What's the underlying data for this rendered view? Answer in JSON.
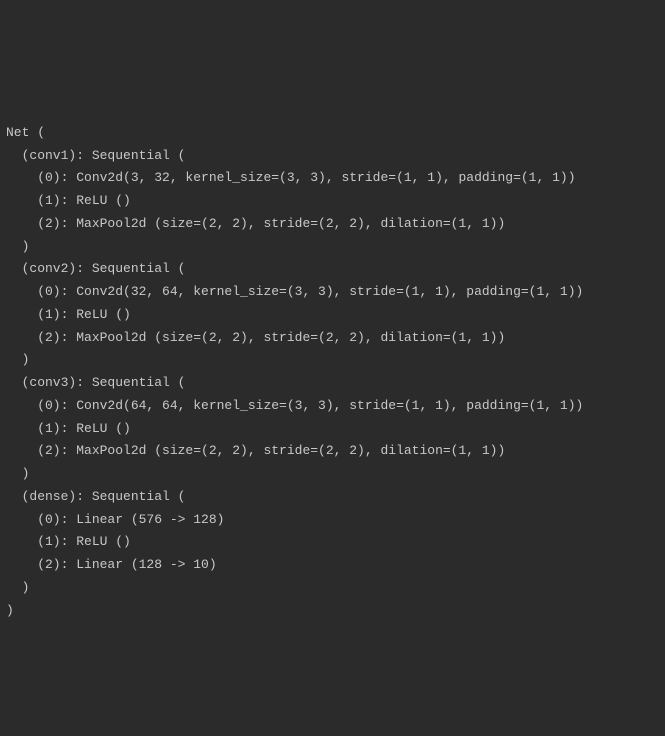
{
  "lines": [
    "Net (",
    "  (conv1): Sequential (",
    "    (0): Conv2d(3, 32, kernel_size=(3, 3), stride=(1, 1), padding=(1, 1))",
    "    (1): ReLU ()",
    "    (2): MaxPool2d (size=(2, 2), stride=(2, 2), dilation=(1, 1))",
    "  )",
    "  (conv2): Sequential (",
    "    (0): Conv2d(32, 64, kernel_size=(3, 3), stride=(1, 1), padding=(1, 1))",
    "    (1): ReLU ()",
    "    (2): MaxPool2d (size=(2, 2), stride=(2, 2), dilation=(1, 1))",
    "  )",
    "  (conv3): Sequential (",
    "    (0): Conv2d(64, 64, kernel_size=(3, 3), stride=(1, 1), padding=(1, 1))",
    "    (1): ReLU ()",
    "    (2): MaxPool2d (size=(2, 2), stride=(2, 2), dilation=(1, 1))",
    "  )",
    "  (dense): Sequential (",
    "    (0): Linear (576 -> 128)",
    "    (1): ReLU ()",
    "    (2): Linear (128 -> 10)",
    "  )",
    ")"
  ]
}
